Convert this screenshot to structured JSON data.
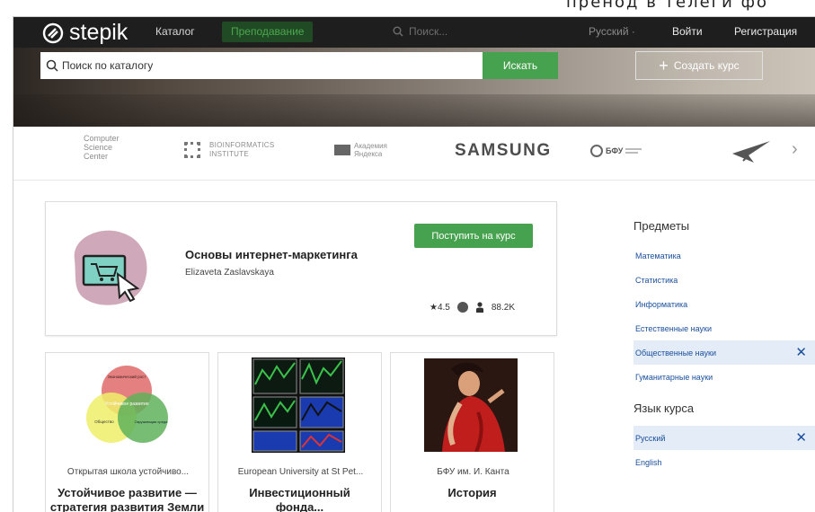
{
  "top_caption": "пренод в телеги фо",
  "navbar": {
    "logo_text": "stepik",
    "catalog": "Каталог",
    "teach": "Преподавание",
    "search": "Поиск...",
    "language": "Русский ·",
    "login": "Войти",
    "register": "Регистрация"
  },
  "hero": {
    "search_placeholder": "Поиск по каталогу",
    "search_button": "Искать",
    "create_course": "Создать курс"
  },
  "partners": {
    "csc": "Computer Science Center",
    "bio_line1": "BIOINFORMATICS",
    "bio_line2": "INSTITUTE",
    "ya_line1": "Академия",
    "ya_line2": "Яндекса",
    "samsung": "SAMSUNG",
    "bfu": "БФУ"
  },
  "featured": {
    "title": "Основы интернет-маркетинга",
    "author": "Elizaveta Zaslavskaya",
    "enroll": "Поступить на курс",
    "rating": "★4.5",
    "learners": "88.2K",
    "colors": {
      "blob": "#cfa9b9",
      "screen": "#7fd1c4"
    }
  },
  "cards": [
    {
      "org": "Открытая школа устойчиво...",
      "title": "Устойчивое развитие —",
      "title2": "стратегия развития Земли",
      "venn": [
        "Экономический рост",
        "Устойчивое развитие",
        "Общество",
        "Окружающая среда"
      ]
    },
    {
      "org": "European University at St Pet...",
      "title": "Инвестиционный",
      "title2": "фонда..."
    },
    {
      "org": "БФУ им. И. Канта",
      "title": "История",
      "title2": ""
    }
  ],
  "sidebar": {
    "subjects_heading": "Предметы",
    "subjects": [
      {
        "label": "Математика",
        "active": false
      },
      {
        "label": "Статистика",
        "active": false
      },
      {
        "label": "Информатика",
        "active": false
      },
      {
        "label": "Естественные науки",
        "active": false
      },
      {
        "label": "Общественные науки",
        "active": true
      },
      {
        "label": "Гуманитарные науки",
        "active": false
      }
    ],
    "language_heading": "Язык курса",
    "languages": [
      {
        "label": "Русский",
        "active": true
      },
      {
        "label": "English",
        "active": false
      }
    ],
    "close_glyph": "✕"
  }
}
